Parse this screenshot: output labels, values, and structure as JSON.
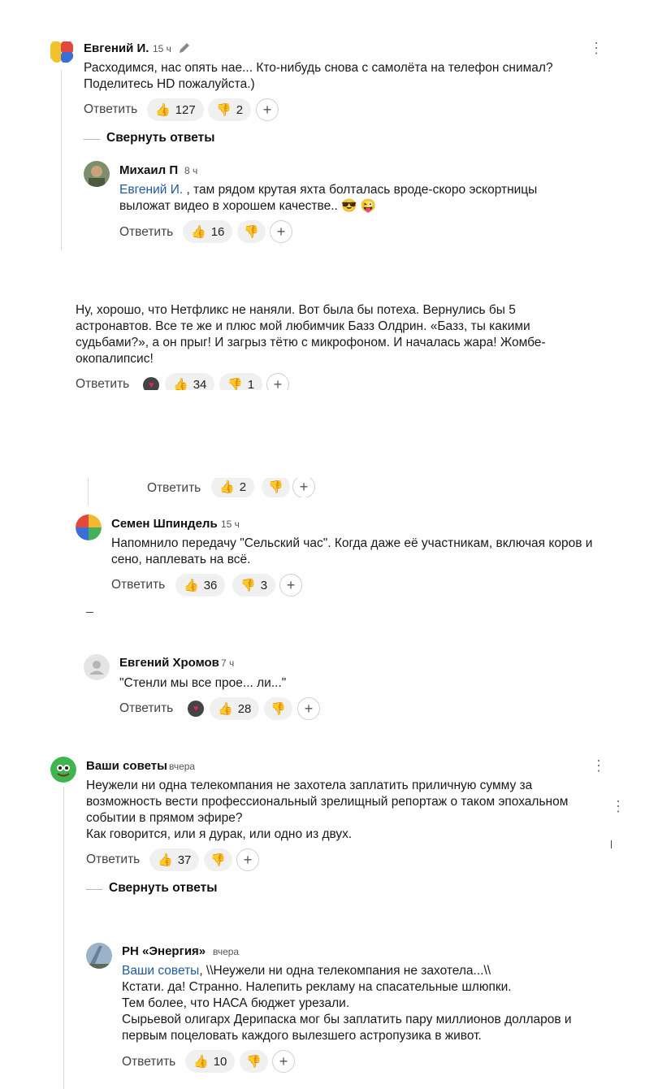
{
  "ui": {
    "reply_label": "Ответить",
    "collapse_label": "Свернуть ответы",
    "plus": "+"
  },
  "c1": {
    "author": "Евгений И.",
    "time": "15 ч",
    "text": "Расходимся, нас опять нае... Кто-нибудь снова с самолёта на телефон снимал? Поделитесь HD пожалуйста.)",
    "likes": "127",
    "dislikes": "2"
  },
  "c2": {
    "author": "Михаил П",
    "time": "8 ч",
    "mention": "Евгений И.",
    "text": " , там рядом крутая яхта болталась вроде-скоро эскортницы выложат видео в хорошем качестве..",
    "emoji": "😎 😜",
    "likes": "16"
  },
  "c3": {
    "text": "Ну, хорошо, что Нетфликс не наняли. Вот была бы потеха. Вернулись бы 5 астронавтов. Все те же и плюс мой любимчик Базз Олдрин. «Базз, ты какими судьбами?», а он прыг! И загрыз тётю с микрофоном. И началась жара! Жомбе-окопалипсис!",
    "likes": "34",
    "dislikes": "1"
  },
  "c4": {
    "likes": "2"
  },
  "c5": {
    "author": "Семен Шпиндель",
    "time": "15 ч",
    "text": "Напомнило передачу \"Сельский час\". Когда даже её участникам, включая коров и сено, наплевать на всё.",
    "likes": "36",
    "dislikes": "3"
  },
  "c6": {
    "author": "Евгений Хромов",
    "time": "7 ч",
    "text": "\"Стенли мы все прое... ли...\"",
    "likes": "28"
  },
  "c7": {
    "author": "Ваши советы",
    "time": "вчера",
    "text": "Неужели ни одна телекомпания не захотела заплатить приличную сумму за возможность вести профессиональный зрелищный репортаж о таком эпохальном событии в прямом эфире?",
    "text2": "Как говорится, или я дурак, или одно из двух.",
    "likes": "37"
  },
  "c8": {
    "author": "РН «Энергия»",
    "time": "вчера",
    "mention": "Ваши советы",
    "text_l1": ", \\\\Неужели ни одна телекомпания не захотела...\\\\",
    "text_l2": "Кстати. да! Странно. Налепить рекламу на спасательные шлюпки.",
    "text_l3": "Тем более, что НАСА бюджет урезали.",
    "text_l4": "Сырьевой олигарх Дерипаска мог бы заплатить пару миллионов долларов и первым поцеловать каждого вылезшего астропузика в живот.",
    "likes": "10"
  },
  "colors": {
    "mention": "#1f5a9e",
    "pill_bg": "#f0f0f0",
    "thread_line": "#dcdcdc"
  },
  "icons": [
    "pencil-icon",
    "thumbs-up-icon",
    "thumbs-down-icon",
    "plus-icon",
    "more-icon",
    "heart-reaction-icon"
  ]
}
